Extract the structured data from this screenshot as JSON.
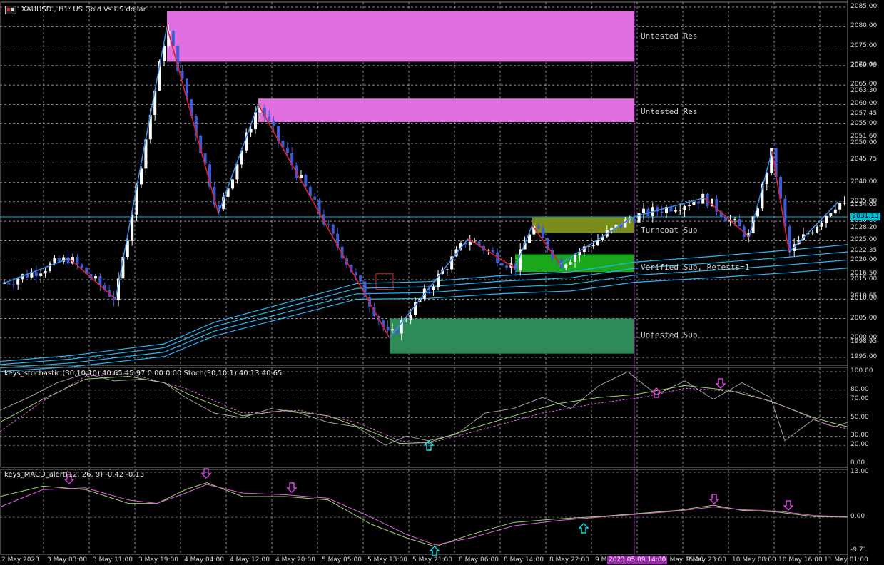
{
  "header": {
    "symbol_title": "XAUUSD., H1:  US Gold vs US dollar",
    "stoch_title": "keys_stochastic (30,10,10) 40.65 45.97 0.00 0.00 Stoch(30,10,1) 40.13 40.65",
    "macd_title": "keys_MACD_alert(12, 26, 9) -0.42 -0.13"
  },
  "icons": {
    "chart_window": "chart-window-icon",
    "arrow_up": "up-arrow-icon",
    "arrow_down": "down-arrow-icon"
  },
  "colors": {
    "background": "#000000",
    "grid": "#ffffff",
    "bull_candle": "#ffffff",
    "bear_candle": "#3b5bd9",
    "zigzag_up": "#3a8ee6",
    "zigzag_down": "#e0202a",
    "ma_lines": "#29b6f6",
    "resistance_zone": "#e070e0",
    "support_zone_untested": "#2e8b57",
    "support_zone_verified": "#1aa81a",
    "support_zone_turncoat": "#7a8c1a",
    "current_price_line": "#00bcd4",
    "cursor_line": "#9c27b0",
    "stoch_main": "#9e9e9e",
    "stoch_signal": "#9bd46a",
    "stoch_dotted": "#e060e0",
    "arrow_buy": "#00e5e5",
    "arrow_sell": "#e040e0"
  },
  "price_axis": {
    "labels": [
      "2085.00",
      "2080.00",
      "2075.00",
      "2070.00",
      "2069.75",
      "2065.00",
      "2063.30",
      "2060.00",
      "2057.45",
      "2055.00",
      "2051.60",
      "2050.00",
      "2045.75",
      "2040.00",
      "2035.00",
      "2034.05",
      "2030.00",
      "2028.20",
      "2025.00",
      "2022.35",
      "2020.00",
      "2016.50",
      "2015.00",
      "2010.65",
      "2010.00",
      "2005.00",
      "2000.00",
      "1998.95",
      "1995.00"
    ],
    "current_price_label": "2031.13"
  },
  "stoch_axis": {
    "labels": [
      "100.00",
      "80.00",
      "70.00",
      "50.00",
      "30.00",
      "20.00",
      "0.00"
    ]
  },
  "macd_axis": {
    "labels": [
      "13.00",
      "0.00",
      "-9.71"
    ]
  },
  "time_axis": {
    "labels": [
      "2 May 2023",
      "3 May 03:00",
      "3 May 11:00",
      "3 May 19:00",
      "4 May 04:00",
      "4 May 12:00",
      "4 May 20:00",
      "5 May 05:00",
      "5 May 13:00",
      "5 May 21:00",
      "8 May 06:00",
      "8 May 14:00",
      "8 May 22:00",
      "9 M",
      "9 May 15:00",
      "9 May 23:00",
      "10 May 08:00",
      "10 May 16:00",
      "11 May 01:00"
    ],
    "cursor_time": "2023.05.09 14:00"
  },
  "zones": {
    "res_top": "Untested Res",
    "res_mid": "Untested Res",
    "turncoat": "Turncoat Sup",
    "verified": "Verified Sup, Retests=1",
    "sup_bottom": "Untested Sup"
  }
}
